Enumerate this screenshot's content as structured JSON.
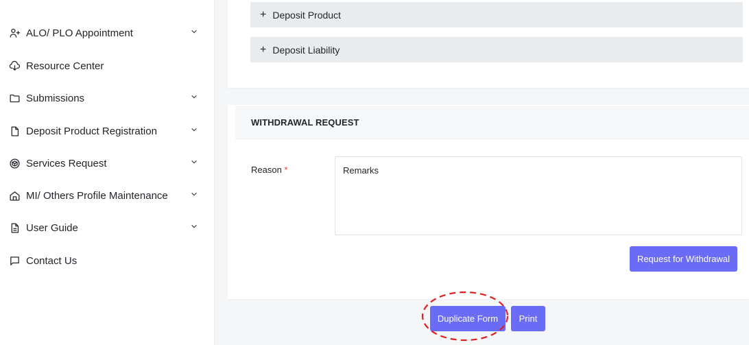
{
  "sidebar": {
    "items": [
      {
        "label": "ALO/ PLO Appointment",
        "icon": "user-plus-icon",
        "has_chevron": true
      },
      {
        "label": "Resource Center",
        "icon": "cloud-download-icon",
        "has_chevron": false
      },
      {
        "label": "Submissions",
        "icon": "folder-icon",
        "has_chevron": true
      },
      {
        "label": "Deposit Product Registration",
        "icon": "file-icon",
        "has_chevron": true
      },
      {
        "label": "Services Request",
        "icon": "box-icon",
        "has_chevron": true
      },
      {
        "label": "MI/ Others Profile Maintenance",
        "icon": "home-icon",
        "has_chevron": true
      },
      {
        "label": "User Guide",
        "icon": "document-icon",
        "has_chevron": true
      },
      {
        "label": "Contact Us",
        "icon": "message-square-icon",
        "has_chevron": false
      }
    ]
  },
  "accordion": {
    "plus_symbol": "+",
    "items": [
      {
        "label": "Deposit Product"
      },
      {
        "label": "Deposit Liability"
      }
    ]
  },
  "withdrawal": {
    "title": "WITHDRAWAL REQUEST",
    "reason_label": "Reason",
    "required_mark": "*",
    "remarks_placeholder": "Remarks",
    "submit_label": "Request for Withdrawal"
  },
  "actions": {
    "duplicate_label": "Duplicate Form",
    "print_label": "Print"
  },
  "colors": {
    "primary_button": "#6a6cf6",
    "accordion_bg": "#e9ecef",
    "required": "#e53935",
    "highlight_ring": "#e02020"
  }
}
